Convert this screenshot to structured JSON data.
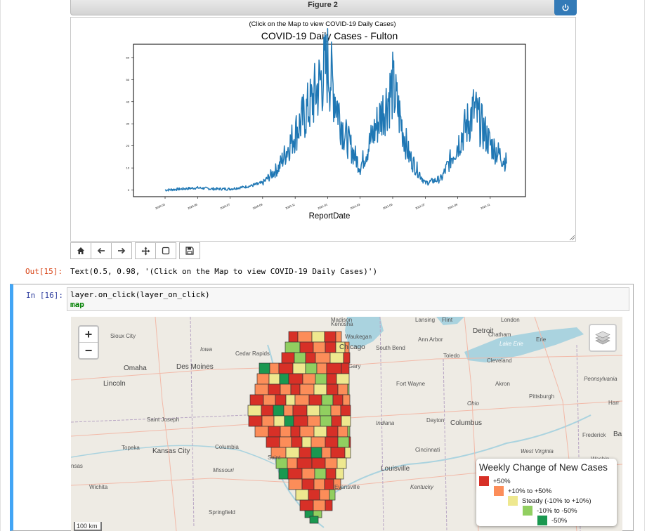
{
  "figure": {
    "header_title": "Figure 2",
    "subtitle": "(Click on the Map to view COVID-19 Daily Cases)",
    "title": "COVID-19 Daily Cases - Fulton",
    "xlabel": "ReportDate"
  },
  "chart_data": {
    "type": "line",
    "title": "COVID-19 Daily Cases - Fulton",
    "subtitle": "(Click on the Map to view COVID-19 Daily Cases)",
    "xlabel": "ReportDate",
    "ylabel": "",
    "x_tick_labels": [
      "2020-03",
      "2020-05",
      "2020-07",
      "2020-09",
      "2020-11",
      "2021-01",
      "2021-03",
      "2021-05",
      "2021-07",
      "2021-09",
      "2021-11"
    ],
    "y_ticks": [
      0,
      10,
      20,
      30,
      40,
      50,
      60
    ],
    "ylim": [
      -3,
      66
    ],
    "series": [
      {
        "color": "#1f77b4",
        "points": [
          {
            "x": "2020-03",
            "y": 0
          },
          {
            "x": "2020-04",
            "y": 0.5
          },
          {
            "x": "2020-05",
            "y": 1
          },
          {
            "x": "2020-06",
            "y": 0.5
          },
          {
            "x": "2020-07",
            "y": 0.5
          },
          {
            "x": "2020-08",
            "y": 1.5
          },
          {
            "x": "2020-09",
            "y": 3
          },
          {
            "x": "2020-10",
            "y": 10
          },
          {
            "x": "2020-11",
            "y": 25
          },
          {
            "x": "2020-12",
            "y": 38
          },
          {
            "x": "2021-01",
            "y": 55
          },
          {
            "x": "2021-02",
            "y": 25
          },
          {
            "x": "2021-03",
            "y": 10
          },
          {
            "x": "2021-04",
            "y": 28
          },
          {
            "x": "2021-05",
            "y": 45
          },
          {
            "x": "2021-06",
            "y": 15
          },
          {
            "x": "2021-07",
            "y": 3
          },
          {
            "x": "2021-08",
            "y": 5
          },
          {
            "x": "2021-09",
            "y": 20
          },
          {
            "x": "2021-10",
            "y": 35
          },
          {
            "x": "2021-11",
            "y": 20
          },
          {
            "x": "2021-12",
            "y": 12
          }
        ]
      }
    ]
  },
  "toolbar": {
    "buttons": [
      "home-icon",
      "back-arrow-icon",
      "forward-arrow-icon",
      "pan-icon",
      "zoom-rect-icon",
      "save-icon"
    ]
  },
  "output": {
    "prompt": "Out[15]:",
    "text": "Text(0.5, 0.98, '(Click on the Map to view COVID-19 Daily Cases)')"
  },
  "cell": {
    "prompt": "In [16]:",
    "code_line1": "layer.on_click(layer_on_click)",
    "code_line2": "map"
  },
  "map": {
    "zoom_in": "+",
    "zoom_out": "−",
    "scale": "100 km",
    "cities": [
      "Madison",
      "Kenosha",
      "Lansing",
      "Flint",
      "London",
      "Detroit",
      "Chatham",
      "Sioux City",
      "Waukegan",
      "Ann Arbor",
      "Erie",
      "Lake Erie",
      "Chicago",
      "South Bend",
      "Toledo",
      "Iowa",
      "Cedar Rapids",
      "Cleveland",
      "Gary",
      "Omaha",
      "Des Moines",
      "Fort Wayne",
      "Akron",
      "Pennsylvania",
      "Lincoln",
      "Pittsburgh",
      "Harr",
      "Ohio",
      "Saint Joseph",
      "Indiana",
      "Dayton",
      "Columbus",
      "Topeka",
      "Kansas City",
      "Columbia",
      "Frederick",
      "Ba",
      "Cincinnati",
      "West Virginia",
      "Missouri",
      "Saint",
      "Louisville",
      "nsas",
      "Wichita",
      "Evansville",
      "Kentucky",
      "Springfield",
      "Washin"
    ],
    "legend": {
      "title": "Weekly Change of New Cases",
      "items": [
        {
          "label": "+50%",
          "color": "#d73027"
        },
        {
          "label": "+10% to +50%",
          "color": "#fc8d59"
        },
        {
          "label": "Steady (-10% to +10%)",
          "color": "#eee88f"
        },
        {
          "label": "-10% to -50%",
          "color": "#91cf60"
        },
        {
          "label": "-50%",
          "color": "#1a9850"
        }
      ]
    }
  }
}
